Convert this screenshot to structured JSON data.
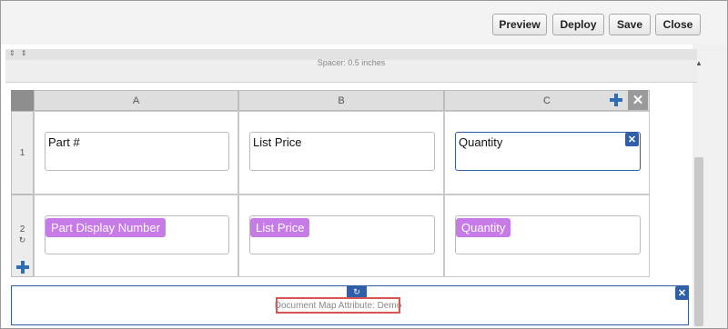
{
  "toolbar": {
    "preview_label": "Preview",
    "deploy_label": "Deploy",
    "save_label": "Save",
    "close_label": "Close"
  },
  "spacer": {
    "label": "Spacer: 0.5 inches"
  },
  "grid": {
    "columns": [
      "A",
      "B",
      "C"
    ],
    "rows": [
      {
        "number": "1",
        "cells": [
          {
            "type": "text",
            "value": "Part #"
          },
          {
            "type": "text",
            "value": "List Price"
          },
          {
            "type": "text",
            "value": "Quantity"
          }
        ]
      },
      {
        "number": "2",
        "cells": [
          {
            "type": "attribute",
            "value": "Part Display Number"
          },
          {
            "type": "attribute",
            "value": "List Price"
          },
          {
            "type": "attribute",
            "value": "Quantity"
          }
        ]
      }
    ]
  },
  "document_map": {
    "label": "Document Map Attribute: Demo"
  },
  "icons": {
    "add": "plus-icon",
    "close": "close-icon",
    "refresh": "refresh-icon",
    "move": "move-arrows-icon"
  },
  "colors": {
    "accent": "#2f5fa8",
    "attribute_chip": "#c77be7",
    "highlight": "#d9534f"
  }
}
